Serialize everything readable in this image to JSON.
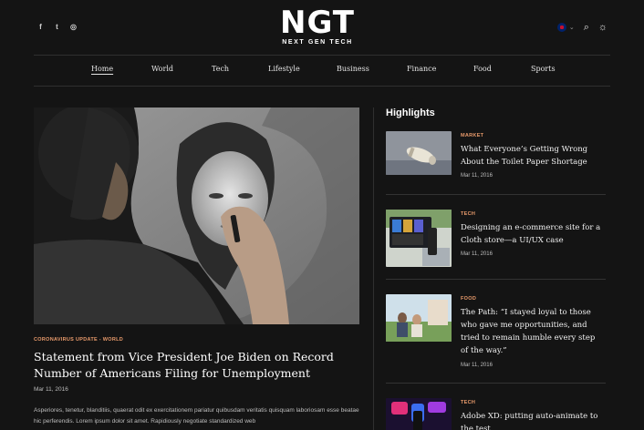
{
  "header": {
    "social": [
      {
        "icon": "facebook-icon",
        "glyph": "f"
      },
      {
        "icon": "twitter-icon",
        "glyph": "t"
      },
      {
        "icon": "instagram-icon",
        "glyph": "◎"
      }
    ],
    "logo_mark": "NGT",
    "logo_sub": "NEXT GEN TECH",
    "tools": {
      "language_icon": "uk-flag-icon",
      "search_glyph": "⌕",
      "theme_glyph": "☼"
    }
  },
  "nav": {
    "items": [
      {
        "label": "Home",
        "active": true
      },
      {
        "label": "World"
      },
      {
        "label": "Tech"
      },
      {
        "label": "Lifestyle"
      },
      {
        "label": "Business"
      },
      {
        "label": "Finance"
      },
      {
        "label": "Food"
      },
      {
        "label": "Sports"
      }
    ]
  },
  "hero": {
    "category": "CORONAVIRUS UPDATE - WORLD",
    "title": "Statement from Vice President Joe Biden on Record Number of Americans Filing for Unemployment",
    "date": "Mar 11, 2016",
    "excerpt": "Asperiores, tenetur, blanditiis, quaerat odit ex exercitationem pariatur quibusdam veritatis quisquam laboriosam esse beatae hic perferendis. Lorem ipsum dolor sit amet. Rapidiously negotiate standardized web"
  },
  "highlights": {
    "heading": "Highlights",
    "items": [
      {
        "category": "MARKET",
        "title": "What Everyone’s Getting Wrong About the Toilet Paper Shortage",
        "date": "Mar 11, 2016"
      },
      {
        "category": "TECH",
        "title": "Designing an e-commerce site for a Cloth store—a UI/UX case",
        "date": "Mar 11, 2016"
      },
      {
        "category": "FOOD",
        "title": "The Path: “I stayed loyal to those who gave me opportunities, and tried to remain humble every step of the way.”",
        "date": "Mar 11, 2016"
      },
      {
        "category": "TECH",
        "title": "Adobe XD: putting auto-animate to the test",
        "date": ""
      }
    ]
  },
  "colors": {
    "background": "#141414",
    "accent": "#e89a6b",
    "text": "#ffffff"
  }
}
